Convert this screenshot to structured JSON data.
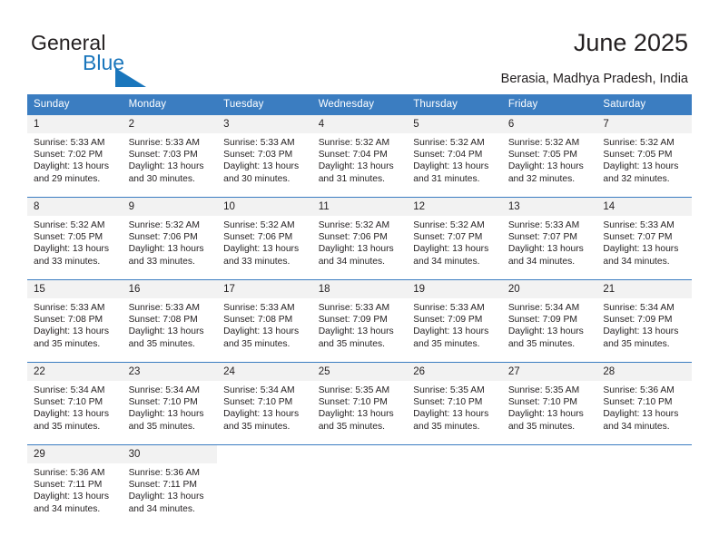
{
  "brand": {
    "name_part1": "General",
    "name_part2": "Blue",
    "triangle_color": "#1a76bc"
  },
  "header": {
    "title": "June 2025",
    "location": "Berasia, Madhya Pradesh, India"
  },
  "theme": {
    "header_row_color": "#3b7dc1",
    "daynum_band_color": "#f2f2f2",
    "text_color": "#231f20"
  },
  "weekday_headers": [
    "Sunday",
    "Monday",
    "Tuesday",
    "Wednesday",
    "Thursday",
    "Friday",
    "Saturday"
  ],
  "weeks": [
    [
      {
        "day": "1",
        "sunrise": "Sunrise: 5:33 AM",
        "sunset": "Sunset: 7:02 PM",
        "daylight1": "Daylight: 13 hours",
        "daylight2": "and 29 minutes."
      },
      {
        "day": "2",
        "sunrise": "Sunrise: 5:33 AM",
        "sunset": "Sunset: 7:03 PM",
        "daylight1": "Daylight: 13 hours",
        "daylight2": "and 30 minutes."
      },
      {
        "day": "3",
        "sunrise": "Sunrise: 5:33 AM",
        "sunset": "Sunset: 7:03 PM",
        "daylight1": "Daylight: 13 hours",
        "daylight2": "and 30 minutes."
      },
      {
        "day": "4",
        "sunrise": "Sunrise: 5:32 AM",
        "sunset": "Sunset: 7:04 PM",
        "daylight1": "Daylight: 13 hours",
        "daylight2": "and 31 minutes."
      },
      {
        "day": "5",
        "sunrise": "Sunrise: 5:32 AM",
        "sunset": "Sunset: 7:04 PM",
        "daylight1": "Daylight: 13 hours",
        "daylight2": "and 31 minutes."
      },
      {
        "day": "6",
        "sunrise": "Sunrise: 5:32 AM",
        "sunset": "Sunset: 7:05 PM",
        "daylight1": "Daylight: 13 hours",
        "daylight2": "and 32 minutes."
      },
      {
        "day": "7",
        "sunrise": "Sunrise: 5:32 AM",
        "sunset": "Sunset: 7:05 PM",
        "daylight1": "Daylight: 13 hours",
        "daylight2": "and 32 minutes."
      }
    ],
    [
      {
        "day": "8",
        "sunrise": "Sunrise: 5:32 AM",
        "sunset": "Sunset: 7:05 PM",
        "daylight1": "Daylight: 13 hours",
        "daylight2": "and 33 minutes."
      },
      {
        "day": "9",
        "sunrise": "Sunrise: 5:32 AM",
        "sunset": "Sunset: 7:06 PM",
        "daylight1": "Daylight: 13 hours",
        "daylight2": "and 33 minutes."
      },
      {
        "day": "10",
        "sunrise": "Sunrise: 5:32 AM",
        "sunset": "Sunset: 7:06 PM",
        "daylight1": "Daylight: 13 hours",
        "daylight2": "and 33 minutes."
      },
      {
        "day": "11",
        "sunrise": "Sunrise: 5:32 AM",
        "sunset": "Sunset: 7:06 PM",
        "daylight1": "Daylight: 13 hours",
        "daylight2": "and 34 minutes."
      },
      {
        "day": "12",
        "sunrise": "Sunrise: 5:32 AM",
        "sunset": "Sunset: 7:07 PM",
        "daylight1": "Daylight: 13 hours",
        "daylight2": "and 34 minutes."
      },
      {
        "day": "13",
        "sunrise": "Sunrise: 5:33 AM",
        "sunset": "Sunset: 7:07 PM",
        "daylight1": "Daylight: 13 hours",
        "daylight2": "and 34 minutes."
      },
      {
        "day": "14",
        "sunrise": "Sunrise: 5:33 AM",
        "sunset": "Sunset: 7:07 PM",
        "daylight1": "Daylight: 13 hours",
        "daylight2": "and 34 minutes."
      }
    ],
    [
      {
        "day": "15",
        "sunrise": "Sunrise: 5:33 AM",
        "sunset": "Sunset: 7:08 PM",
        "daylight1": "Daylight: 13 hours",
        "daylight2": "and 35 minutes."
      },
      {
        "day": "16",
        "sunrise": "Sunrise: 5:33 AM",
        "sunset": "Sunset: 7:08 PM",
        "daylight1": "Daylight: 13 hours",
        "daylight2": "and 35 minutes."
      },
      {
        "day": "17",
        "sunrise": "Sunrise: 5:33 AM",
        "sunset": "Sunset: 7:08 PM",
        "daylight1": "Daylight: 13 hours",
        "daylight2": "and 35 minutes."
      },
      {
        "day": "18",
        "sunrise": "Sunrise: 5:33 AM",
        "sunset": "Sunset: 7:09 PM",
        "daylight1": "Daylight: 13 hours",
        "daylight2": "and 35 minutes."
      },
      {
        "day": "19",
        "sunrise": "Sunrise: 5:33 AM",
        "sunset": "Sunset: 7:09 PM",
        "daylight1": "Daylight: 13 hours",
        "daylight2": "and 35 minutes."
      },
      {
        "day": "20",
        "sunrise": "Sunrise: 5:34 AM",
        "sunset": "Sunset: 7:09 PM",
        "daylight1": "Daylight: 13 hours",
        "daylight2": "and 35 minutes."
      },
      {
        "day": "21",
        "sunrise": "Sunrise: 5:34 AM",
        "sunset": "Sunset: 7:09 PM",
        "daylight1": "Daylight: 13 hours",
        "daylight2": "and 35 minutes."
      }
    ],
    [
      {
        "day": "22",
        "sunrise": "Sunrise: 5:34 AM",
        "sunset": "Sunset: 7:10 PM",
        "daylight1": "Daylight: 13 hours",
        "daylight2": "and 35 minutes."
      },
      {
        "day": "23",
        "sunrise": "Sunrise: 5:34 AM",
        "sunset": "Sunset: 7:10 PM",
        "daylight1": "Daylight: 13 hours",
        "daylight2": "and 35 minutes."
      },
      {
        "day": "24",
        "sunrise": "Sunrise: 5:34 AM",
        "sunset": "Sunset: 7:10 PM",
        "daylight1": "Daylight: 13 hours",
        "daylight2": "and 35 minutes."
      },
      {
        "day": "25",
        "sunrise": "Sunrise: 5:35 AM",
        "sunset": "Sunset: 7:10 PM",
        "daylight1": "Daylight: 13 hours",
        "daylight2": "and 35 minutes."
      },
      {
        "day": "26",
        "sunrise": "Sunrise: 5:35 AM",
        "sunset": "Sunset: 7:10 PM",
        "daylight1": "Daylight: 13 hours",
        "daylight2": "and 35 minutes."
      },
      {
        "day": "27",
        "sunrise": "Sunrise: 5:35 AM",
        "sunset": "Sunset: 7:10 PM",
        "daylight1": "Daylight: 13 hours",
        "daylight2": "and 35 minutes."
      },
      {
        "day": "28",
        "sunrise": "Sunrise: 5:36 AM",
        "sunset": "Sunset: 7:10 PM",
        "daylight1": "Daylight: 13 hours",
        "daylight2": "and 34 minutes."
      }
    ],
    [
      {
        "day": "29",
        "sunrise": "Sunrise: 5:36 AM",
        "sunset": "Sunset: 7:11 PM",
        "daylight1": "Daylight: 13 hours",
        "daylight2": "and 34 minutes."
      },
      {
        "day": "30",
        "sunrise": "Sunrise: 5:36 AM",
        "sunset": "Sunset: 7:11 PM",
        "daylight1": "Daylight: 13 hours",
        "daylight2": "and 34 minutes."
      },
      {
        "day": "",
        "sunrise": "",
        "sunset": "",
        "daylight1": "",
        "daylight2": ""
      },
      {
        "day": "",
        "sunrise": "",
        "sunset": "",
        "daylight1": "",
        "daylight2": ""
      },
      {
        "day": "",
        "sunrise": "",
        "sunset": "",
        "daylight1": "",
        "daylight2": ""
      },
      {
        "day": "",
        "sunrise": "",
        "sunset": "",
        "daylight1": "",
        "daylight2": ""
      },
      {
        "day": "",
        "sunrise": "",
        "sunset": "",
        "daylight1": "",
        "daylight2": ""
      }
    ]
  ]
}
